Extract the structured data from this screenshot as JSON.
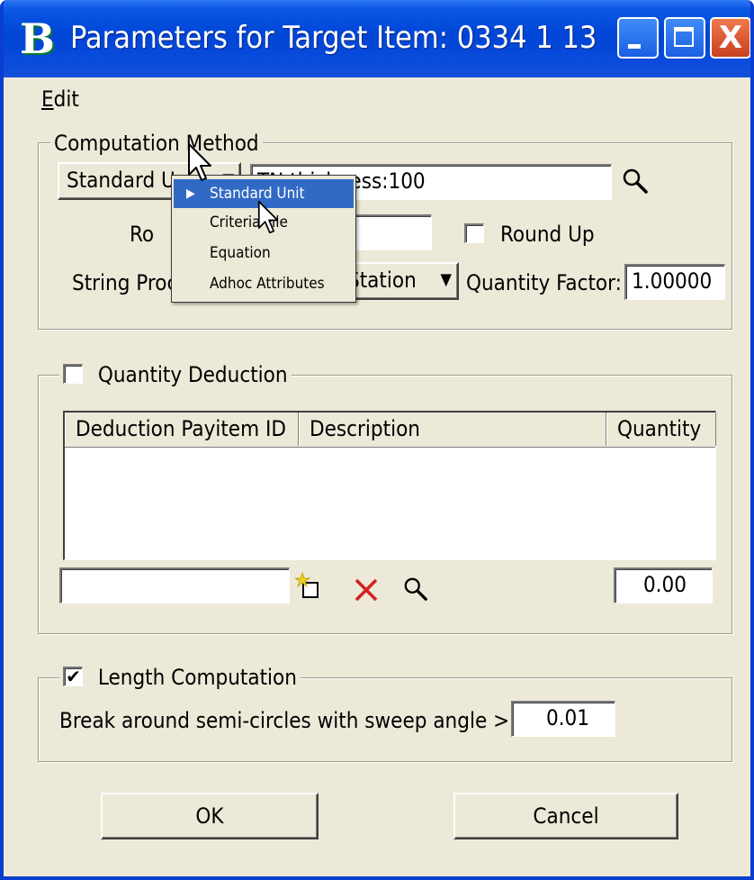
{
  "window": {
    "title": "Parameters for Target Item: 0334  1 13",
    "app_icon_glyph": "B",
    "close_glyph": "X"
  },
  "menu": {
    "edit": "Edit"
  },
  "computation": {
    "legend": "Computation Method",
    "method_selected": "Standard U",
    "method_field": "TN thickness:100",
    "round_label": "Ro",
    "round_value": "",
    "round_up_label": "Round Up",
    "round_up_checked": false,
    "string_processing_label": "String Proc",
    "string_processing_value": "Station",
    "quantity_factor_label": "Quantity Factor:",
    "quantity_factor_value": "1.00000"
  },
  "dropdown_popup": {
    "items": [
      "Standard Unit",
      "Criteria File",
      "Equation",
      "Adhoc Attributes"
    ],
    "selected_index": 0
  },
  "deduction": {
    "legend": "Quantity Deduction",
    "checked": false,
    "columns": [
      "Deduction Payitem ID",
      "Description",
      "Quantity"
    ],
    "rows": [],
    "payitem_input": "",
    "quantity_total": "0.00"
  },
  "length": {
    "legend": "Length Computation",
    "checked": true,
    "check_glyph": "✔",
    "sweep_label": "Break around semi-circles with sweep angle >=",
    "sweep_value": "0.01"
  },
  "buttons": {
    "ok": "OK",
    "cancel": "Cancel"
  },
  "colors": {
    "titlebar": "#0a57e6",
    "dialog_bg": "#ece9d8",
    "selection": "#316ac5",
    "delete_icon": "#d42020"
  }
}
